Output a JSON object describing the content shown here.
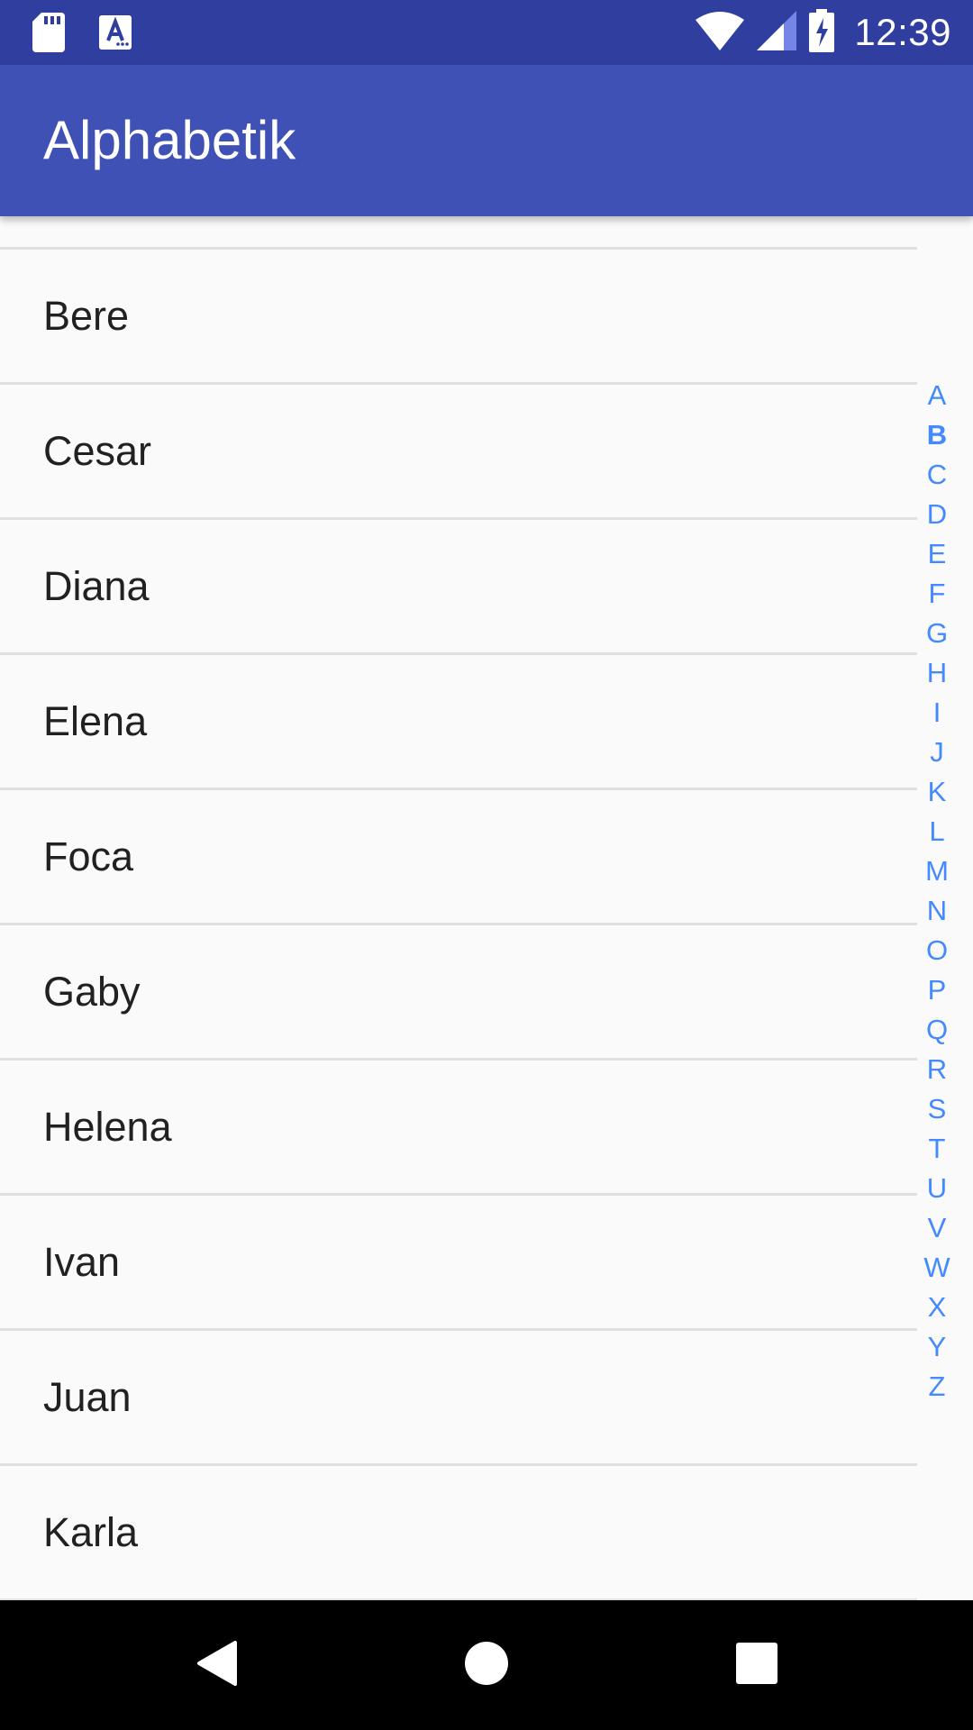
{
  "status_bar": {
    "time": "12:39",
    "icons": [
      "sd-card-icon",
      "text-notification-icon",
      "wifi-icon",
      "cell-signal-icon",
      "battery-charging-icon"
    ]
  },
  "app_bar": {
    "title": "Alphabetik"
  },
  "list": {
    "items": [
      "Bere",
      "Cesar",
      "Diana",
      "Elena",
      "Foca",
      "Gaby",
      "Helena",
      "Ivan",
      "Juan",
      "Karla"
    ]
  },
  "index_bar": {
    "letters": [
      "A",
      "B",
      "C",
      "D",
      "E",
      "F",
      "G",
      "H",
      "I",
      "J",
      "K",
      "L",
      "M",
      "N",
      "O",
      "P",
      "Q",
      "R",
      "S",
      "T",
      "U",
      "V",
      "W",
      "X",
      "Y",
      "Z"
    ],
    "selected": "B",
    "color": "#448aff"
  },
  "nav_bar": {
    "buttons": [
      "back-icon",
      "home-icon",
      "recents-icon"
    ]
  },
  "colors": {
    "status_bar": "#303f9f",
    "app_bar": "#3f51b5",
    "background": "#fafafa",
    "divider": "#e0e0e0",
    "text": "#212121"
  }
}
